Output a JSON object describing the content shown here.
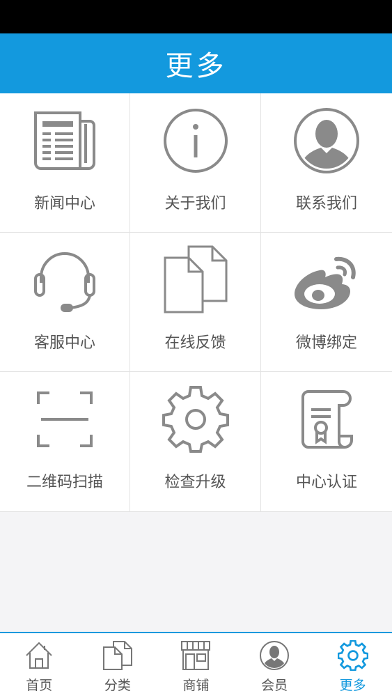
{
  "header": {
    "title": "更多"
  },
  "grid": {
    "items": [
      {
        "label": "新闻中心",
        "icon": "newspaper-icon"
      },
      {
        "label": "关于我们",
        "icon": "info-icon"
      },
      {
        "label": "联系我们",
        "icon": "person-icon"
      },
      {
        "label": "客服中心",
        "icon": "headset-icon"
      },
      {
        "label": "在线反馈",
        "icon": "documents-icon"
      },
      {
        "label": "微博绑定",
        "icon": "weibo-icon"
      },
      {
        "label": "二维码扫描",
        "icon": "scan-icon"
      },
      {
        "label": "检查升级",
        "icon": "gear-icon"
      },
      {
        "label": "中心认证",
        "icon": "certificate-icon"
      }
    ]
  },
  "tabbar": {
    "active": "更多",
    "items": [
      {
        "label": "首页",
        "icon": "home-icon"
      },
      {
        "label": "分类",
        "icon": "category-icon"
      },
      {
        "label": "商铺",
        "icon": "store-icon"
      },
      {
        "label": "会员",
        "icon": "member-icon"
      },
      {
        "label": "更多",
        "icon": "settings-icon"
      }
    ]
  },
  "colors": {
    "accent": "#1399de",
    "icon_gray": "#8a8a8a",
    "text": "#555555",
    "background": "#f4f4f6"
  }
}
